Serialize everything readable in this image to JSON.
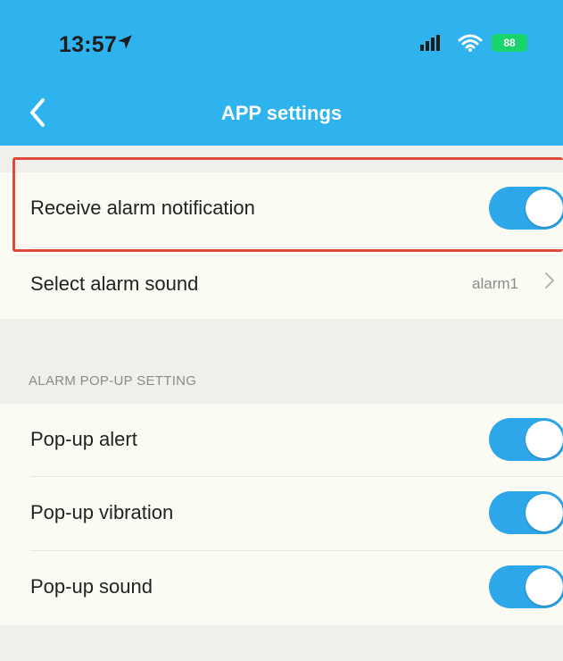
{
  "status_bar": {
    "time": "13:57",
    "battery": "88"
  },
  "nav": {
    "title": "APP settings",
    "back_icon": "chevron-left-icon"
  },
  "settings": {
    "receive_alarm_notification": {
      "label": "Receive alarm notification",
      "enabled": true
    },
    "select_alarm_sound": {
      "label": "Select alarm sound",
      "value": "alarm1"
    }
  },
  "popup_section": {
    "header": "ALARM POP-UP SETTING",
    "items": [
      {
        "label": "Pop-up alert",
        "enabled": true
      },
      {
        "label": "Pop-up vibration",
        "enabled": true
      },
      {
        "label": "Pop-up sound",
        "enabled": true
      }
    ]
  },
  "colors": {
    "nav_bg": "#2fb3ee",
    "toggle_on": "#2ea6ea",
    "highlight": "#dc4b3b"
  }
}
